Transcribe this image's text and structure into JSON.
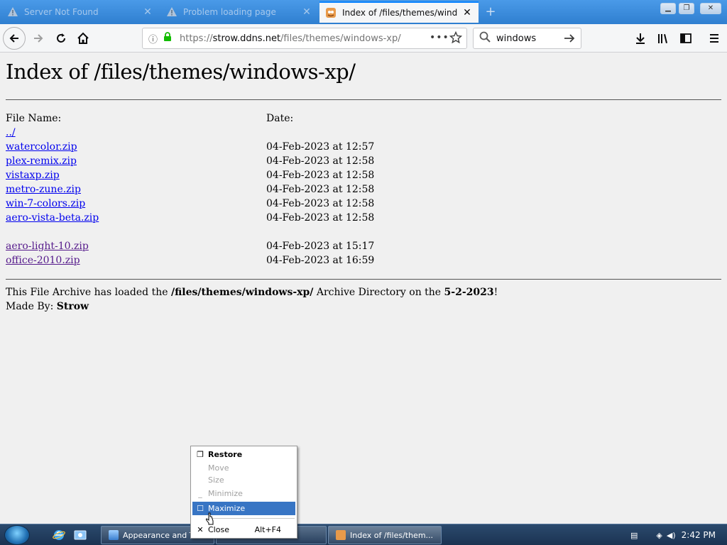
{
  "browser": {
    "tabs": [
      {
        "title": "Server Not Found",
        "state": "inactive"
      },
      {
        "title": "Problem loading page",
        "state": "inactive"
      },
      {
        "title": "Index of /files/themes/windows-xp/",
        "state": "active"
      }
    ],
    "url": {
      "scheme": "https://",
      "host": "strow.ddns.net",
      "path": "/files/themes/windows-xp/"
    },
    "search": {
      "value": "windows"
    },
    "colors": {
      "tabstrip": "#3b8de0",
      "active_tab_accent": "#0a84ff",
      "link": "#0000ee",
      "visited_link": "#551a8b"
    }
  },
  "page": {
    "title": "Index of /files/themes/windows-xp/",
    "columns": {
      "name": "File Name:",
      "date": "Date:"
    },
    "parent_link": "../",
    "files": [
      {
        "name": "watercolor.zip",
        "date": "04-Feb-2023 at 12:57",
        "visited": false
      },
      {
        "name": "plex-remix.zip",
        "date": "04-Feb-2023 at 12:58",
        "visited": false
      },
      {
        "name": "vistaxp.zip",
        "date": "04-Feb-2023 at 12:58",
        "visited": false
      },
      {
        "name": "metro-zune.zip",
        "date": "04-Feb-2023 at 12:58",
        "visited": false
      },
      {
        "name": "win-7-colors.zip",
        "date": "04-Feb-2023 at 12:58",
        "visited": false
      },
      {
        "name": "aero-vista-beta.zip",
        "date": "04-Feb-2023 at 12:58",
        "visited": false
      }
    ],
    "files2": [
      {
        "name": "aero-light-10.zip",
        "date": "04-Feb-2023 at 15:17",
        "visited": true
      },
      {
        "name": "office-2010.zip",
        "date": "04-Feb-2023 at 16:59",
        "visited": true
      }
    ],
    "footer": {
      "line1_pre": "This File Archive has loaded the ",
      "line1_dir": "/files/themes/windows-xp/",
      "line1_mid": " Archive Directory on the ",
      "line1_date": "5-2-2023",
      "line1_end": "!",
      "line2_pre": "Made By: ",
      "line2_author": "Strow"
    }
  },
  "context_menu": {
    "items": [
      {
        "label": "Restore",
        "icon": "restore-icon",
        "state": "bold"
      },
      {
        "label": "Move",
        "icon": "",
        "state": "disabled"
      },
      {
        "label": "Size",
        "icon": "",
        "state": "disabled"
      },
      {
        "label": "Minimize",
        "icon": "minimize-icon",
        "state": "disabled"
      },
      {
        "label": "Maximize",
        "icon": "maximize-icon",
        "state": "highlighted"
      },
      {
        "label": "Close",
        "icon": "close-icon",
        "state": "normal",
        "shortcut": "Alt+F4"
      }
    ]
  },
  "taskbar": {
    "buttons": [
      {
        "label": "Appearance and T"
      },
      {
        "label": "Index of /files/them..."
      }
    ],
    "clock": "2:42 PM"
  }
}
